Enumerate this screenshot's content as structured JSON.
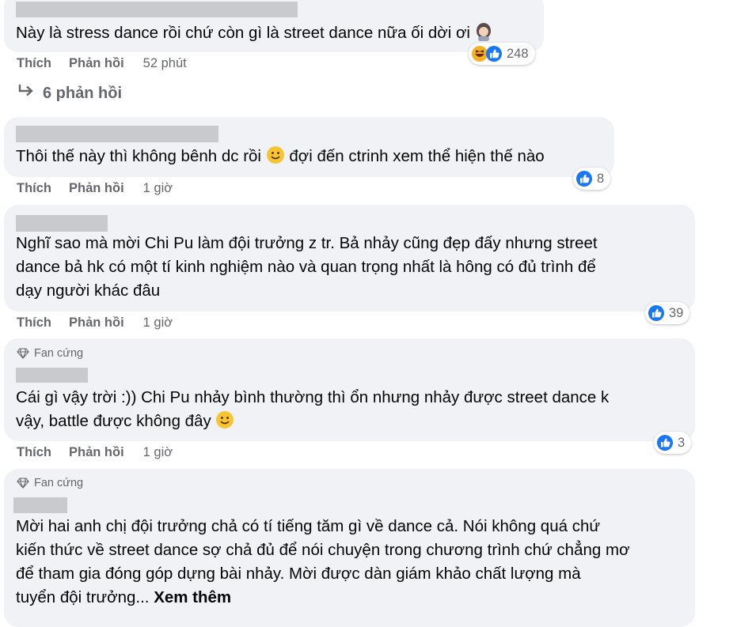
{
  "actions": {
    "like": "Thích",
    "reply": "Phản hồi"
  },
  "comments": [
    {
      "text": "Này là stress dance rồi chứ còn gì là street dance nữa ối dời ơi",
      "time": "52 phút",
      "reaction_count": "248"
    },
    {
      "text_before": "Thôi thế này thì không bênh dc rồi",
      "text_after": "đợi đến ctrinh xem thể hiện thế nào",
      "time": "1 giờ",
      "reaction_count": "8"
    },
    {
      "line1": "Nghĩ sao mà mời Chi Pu làm đội trưởng z tr. Bả nhảy cũng đẹp đấy nhưng street",
      "line2": "dance bả hk có một tí kinh nghiệm nào và quan trọng nhất là hông có đủ trình để",
      "line3": "dạy người khác đâu",
      "time": "1 giờ",
      "reaction_count": "39"
    },
    {
      "badge": "Fan cứng",
      "line1": "Cái gì vậy trời :)) Chi Pu nhảy bình thường thì ổn nhưng nhảy được street dance k",
      "line2": "vậy, battle được không đây",
      "time": "1 giờ",
      "reaction_count": "3"
    },
    {
      "badge": "Fan cứng",
      "line1": "Mời hai anh chị đội trưởng chả có tí tiếng tăm gì về dance cả. Nói không quá chứ",
      "line2": "kiến thức về street dance sợ chả đủ để nói chuyện trong chương trình chứ chẳng mơ",
      "line3": "để tham gia đóng góp dựng bài nhảy. Mời được dàn giám khảo chất lượng mà",
      "line4": "tuyển đội trưởng...",
      "see_more": "Xem thêm"
    }
  ],
  "replies_link": "6 phản hồi",
  "colors": {
    "bubble": "#f0f2f5",
    "like_blue": "#1877f2",
    "muted": "#65676b",
    "text": "#050505"
  }
}
